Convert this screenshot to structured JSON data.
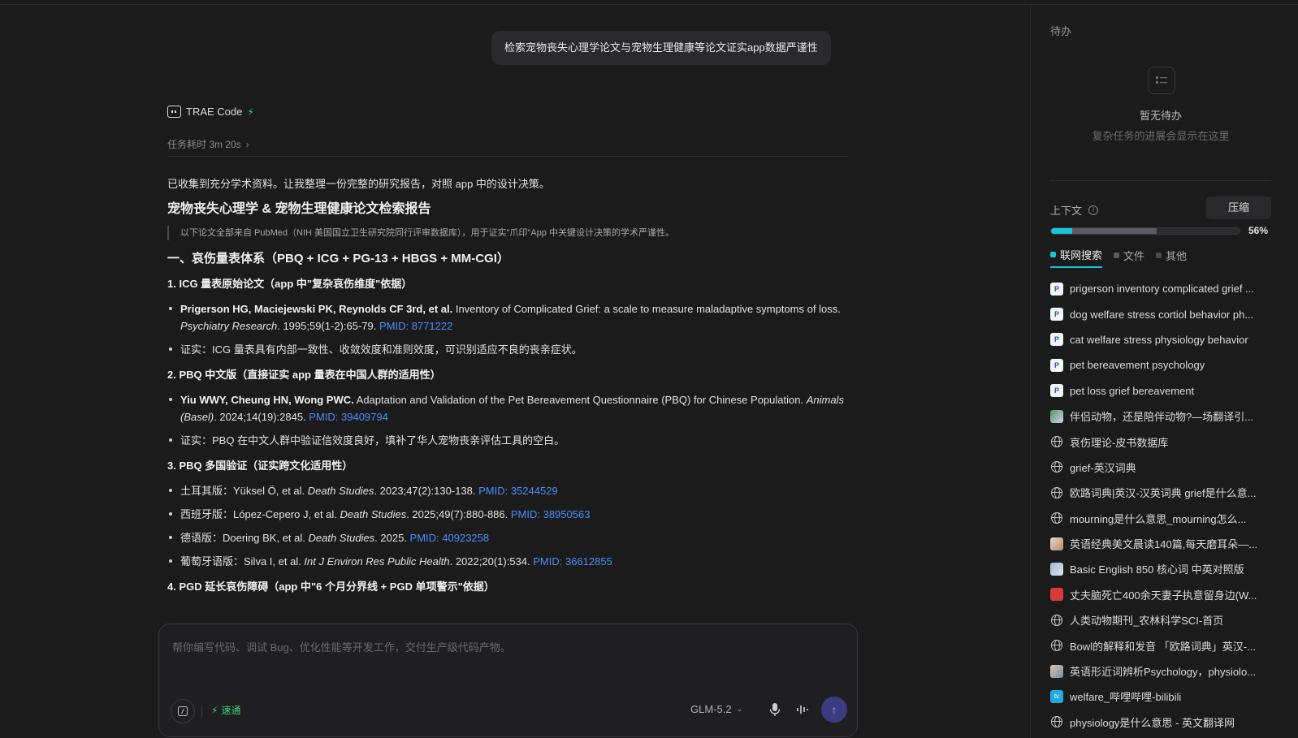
{
  "user_message": "检索宠物丧失心理学论文与宠物生理健康等论文证实app数据严谨性",
  "agent": {
    "name": "TRAE Code",
    "elapsed": "任务耗时 3m 20s"
  },
  "report": {
    "intro": "已收集到充分学术资料。让我整理一份完整的研究报告，对照 app 中的设计决策。",
    "title": "宠物丧失心理学 & 宠物生理健康论文检索报告",
    "quote": "以下论文全部来自 PubMed（NIH 美国国立卫生研究院同行评审数据库），用于证实\"爪印\"App 中关键设计决策的学术严谨性。",
    "section1": "一、哀伤量表体系（PBQ + ICG + PG-13 + HBGS + MM-CGI）",
    "h1": "1. ICG 量表原始论文（app 中\"复杂哀伤维度\"依据）",
    "r1_authors": "Prigerson HG, Maciejewski PK, Reynolds CF 3rd, et al.",
    "r1_title": " Inventory of Complicated Grief: a scale to measure maladaptive symptoms of loss. ",
    "r1_journal": "Psychiatry Research",
    "r1_tail": ". 1995;59(1-2):65-79. ",
    "r1_pmid": "PMID: 8771222",
    "r1_note": "证实：ICG 量表具有内部一致性、收敛效度和准则效度，可识别适应不良的丧亲症状。",
    "h2": "2. PBQ 中文版（直接证实 app 量表在中国人群的适用性）",
    "r2_authors": "Yiu WWY, Cheung HN, Wong PWC.",
    "r2_title": " Adaptation and Validation of the Pet Bereavement Questionnaire (PBQ) for Chinese Population. ",
    "r2_journal": "Animals (Basel)",
    "r2_tail": ". 2024;14(19):2845. ",
    "r2_pmid": "PMID: 39409794",
    "r2_note": "证实：PBQ 在中文人群中验证信效度良好，填补了华人宠物丧亲评估工具的空白。",
    "h3": "3. PBQ 多国验证（证实跨文化适用性）",
    "v1_pre": "土耳其版：Yüksel Ö, et al. ",
    "v1_journal": "Death Studies",
    "v1_tail": ". 2023;47(2):130-138. ",
    "v1_pmid": "PMID: 35244529",
    "v2_pre": "西班牙版：López-Cepero J, et al. ",
    "v2_journal": "Death Studies",
    "v2_tail": ". 2025;49(7):880-886. ",
    "v2_pmid": "PMID: 38950563",
    "v3_pre": "德语版：Doering BK, et al. ",
    "v3_journal": "Death Studies",
    "v3_tail": ". 2025. ",
    "v3_pmid": "PMID: 40923258",
    "v4_pre": "葡萄牙语版：Silva I, et al. ",
    "v4_journal": "Int J Environ Res Public Health",
    "v4_tail": ". 2022;20(1):534. ",
    "v4_pmid": "PMID: 36612855",
    "h4": "4. PGD 延长哀伤障碍（app 中\"6 个月分界线 + PGD 单项警示\"依据）"
  },
  "input": {
    "placeholder": "帮你编写代码、调试 Bug、优化性能等开发工作，交付生产级代码产物。",
    "speed_label": "速通",
    "model": "GLM-5.2"
  },
  "panel": {
    "todo_title": "待办",
    "todo_empty": "暂无待办",
    "todo_hint": "复杂任务的进展会显示在这里",
    "context_label": "上下文",
    "compress_label": "压缩",
    "usage_percent": "56%",
    "usage": {
      "search": 0.11,
      "files": 0.45
    },
    "tabs": [
      "联网搜索",
      "文件",
      "其他"
    ],
    "colors": {
      "search": "#17c3d8",
      "files": "#5c5c60",
      "other": "#4a4a4c"
    },
    "sources": [
      {
        "icon": "pubmed",
        "label": "prigerson inventory complicated grief ..."
      },
      {
        "icon": "pubmed",
        "label": "dog welfare stress cortiol behavior ph..."
      },
      {
        "icon": "pubmed",
        "label": "cat welfare stress physiology behavior"
      },
      {
        "icon": "pubmed",
        "label": "pet bereavement psychology"
      },
      {
        "icon": "pubmed",
        "label": "pet loss grief bereavement"
      },
      {
        "icon": "img1",
        "label": "伴侣动物，还是陪伴动物?—场翻译引..."
      },
      {
        "icon": "globe",
        "label": "哀伤理论-皮书数据库"
      },
      {
        "icon": "globe",
        "label": "grief-英汉词典"
      },
      {
        "icon": "globe",
        "label": "欧路词典|英汉-汉英词典 grief是什么意..."
      },
      {
        "icon": "globe",
        "label": "mourning是什么意思_mourning怎么..."
      },
      {
        "icon": "img2",
        "label": "英语经典美文晨读140篇,每天磨耳朵—..."
      },
      {
        "icon": "img3",
        "label": "Basic English 850 核心词 中英对照版"
      },
      {
        "icon": "img4",
        "label": "丈夫脑死亡400余天妻子执意留身边(W..."
      },
      {
        "icon": "globe",
        "label": "人类动物期刊_农林科学SCI-首页"
      },
      {
        "icon": "globe",
        "label": "Bowl的解释和发音 「欧路词典」英汉-..."
      },
      {
        "icon": "img5",
        "label": "英语形近词辨析Psychology，physiolo..."
      },
      {
        "icon": "bili",
        "label": "welfare_哔哩哔哩-bilibili"
      },
      {
        "icon": "globe",
        "label": "physiology是什么意思 - 英文翻译网"
      }
    ]
  }
}
